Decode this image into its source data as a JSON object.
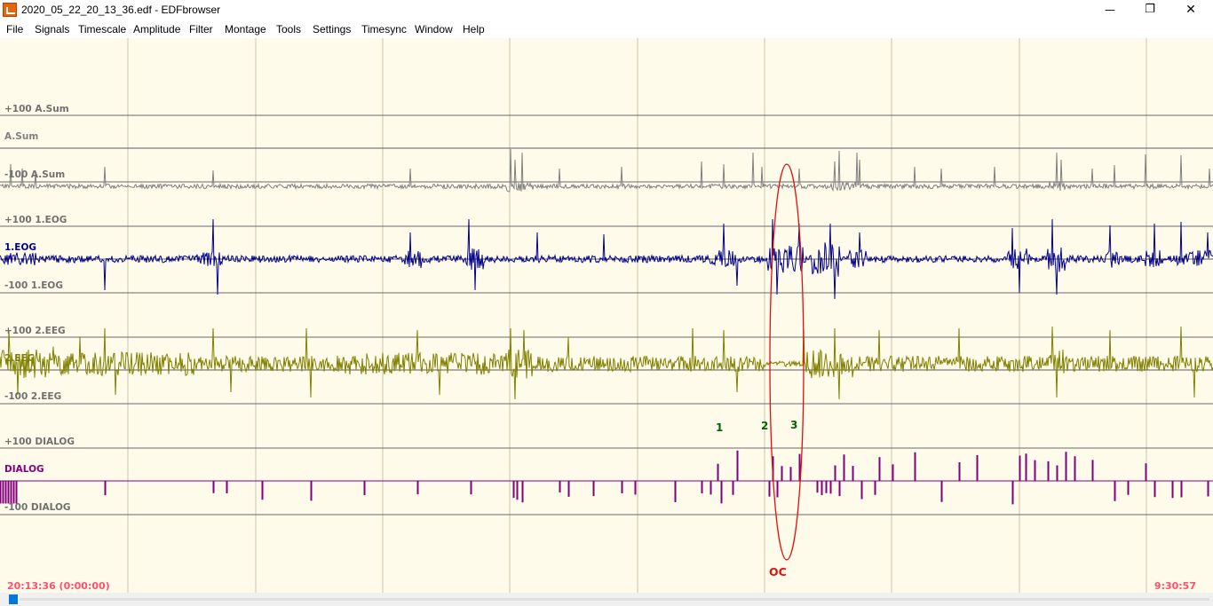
{
  "window": {
    "title": "2020_05_22_20_13_36.edf - EDFbrowser",
    "icon": "edfbrowser-app-icon",
    "minimize_glyph": "—",
    "maximize_glyph": "❐",
    "close_glyph": "✕"
  },
  "menu": [
    "File",
    "Signals",
    "Timescale",
    "Amplitude",
    "Filter",
    "Montage",
    "Tools",
    "Settings",
    "Timesync",
    "Window",
    "Help"
  ],
  "colors": {
    "background": "#fffbea",
    "grid": "#c8c5a8",
    "baseline": "#5a5a5a",
    "asum": "#808080",
    "eog": "#00008b",
    "eeg": "#808000",
    "dialog": "#800080",
    "annotation_red": "#e01010",
    "annotation_green": "#006400",
    "timestamp": "#ff4f6f"
  },
  "signals": [
    {
      "name": "A.Sum",
      "top_label": "+100 A.Sum",
      "mid_label": "A.Sum",
      "bottom_label": "-100 A.Sum",
      "color": "#808080"
    },
    {
      "name": "1.EOG",
      "top_label": "+100 1.EOG",
      "mid_label": "1.EOG",
      "bottom_label": "-100 1.EOG",
      "color": "#00008b"
    },
    {
      "name": "2.EEG",
      "top_label": "+100 2.EEG",
      "mid_label": "2.EEG",
      "bottom_label": "-100 2.EEG",
      "color": "#808000"
    },
    {
      "name": "DIALOG",
      "top_label": "+100 DIALOG",
      "mid_label": "DIALOG",
      "bottom_label": "-100 DIALOG",
      "color": "#800080"
    }
  ],
  "annotations": {
    "markers": [
      "1",
      "2",
      "3"
    ],
    "ellipse_label": "OC"
  },
  "status": {
    "start_time": "20:13:36 (0:00:00)",
    "duration": "9:30:57"
  }
}
